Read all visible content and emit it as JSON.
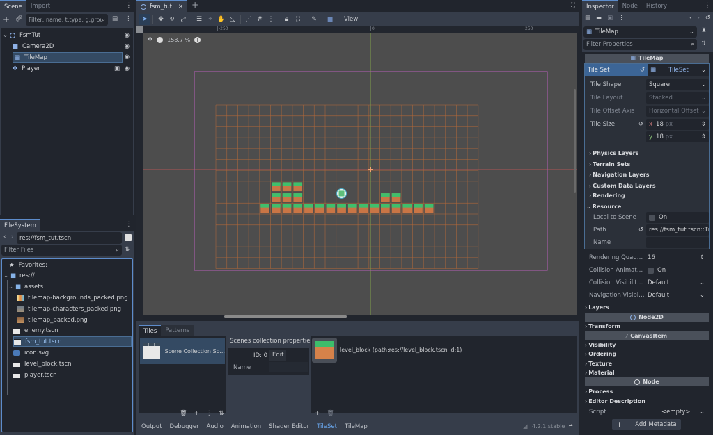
{
  "scene_dock": {
    "tabs": [
      "Scene",
      "Import"
    ],
    "filter_placeholder": "Filter: name, t:type, g:group",
    "nodes": [
      {
        "name": "FsmTut",
        "icon": "node2d-icon"
      },
      {
        "name": "Camera2D",
        "icon": "camera2d-icon"
      },
      {
        "name": "TileMap",
        "icon": "tilemap-icon",
        "selected": true
      },
      {
        "name": "Player",
        "icon": "characterbody-icon"
      }
    ]
  },
  "filesystem": {
    "tab": "FileSystem",
    "path": "res://fsm_tut.tscn",
    "filter_placeholder": "Filter Files",
    "favorites_label": "Favorites:",
    "root": "res://",
    "folder": "assets",
    "asset_files": [
      "tilemap-backgrounds_packed.png",
      "tilemap-characters_packed.png",
      "tilemap_packed.png"
    ],
    "root_files": [
      "enemy.tscn",
      "fsm_tut.tscn",
      "icon.svg",
      "level_block.tscn",
      "player.tscn"
    ],
    "selected_file": "fsm_tut.tscn"
  },
  "editor": {
    "scene_tab": "fsm_tut",
    "view_menu": "View",
    "zoom_level": "158.7 %",
    "ruler_labels": [
      "-250",
      "0",
      "250"
    ]
  },
  "bottom_panel": {
    "tabs": [
      "Tiles",
      "Patterns"
    ],
    "source_item": "Scene Collection So...",
    "props_title": "Scenes collection properties:",
    "id_label": "ID: 0",
    "edit_label": "Edit",
    "name_label": "Name",
    "scene_entry": "level_block (path:res://level_block.tscn id:1)",
    "dock_tabs": [
      "Output",
      "Debugger",
      "Audio",
      "Animation",
      "Shader Editor",
      "TileSet",
      "TileMap"
    ],
    "active_dock_tab": "TileSet",
    "version": "4.2.1.stable"
  },
  "inspector": {
    "tabs": [
      "Inspector",
      "Node",
      "History"
    ],
    "object_name": "TileMap",
    "filter_placeholder": "Filter Properties",
    "class_header": "TileMap",
    "tile_set_label": "Tile Set",
    "tile_set_value": "TileSet",
    "tile_shape_label": "Tile Shape",
    "tile_shape_value": "Square",
    "tile_layout_label": "Tile Layout",
    "tile_layout_value": "Stacked",
    "tile_offset_label": "Tile Offset Axis",
    "tile_offset_value": "Horizontal Offset",
    "tile_size_label": "Tile Size",
    "tile_size_x": "18",
    "tile_size_y": "18",
    "unit": "px",
    "x_label": "x",
    "y_label": "y",
    "subsections": [
      "Physics Layers",
      "Terrain Sets",
      "Navigation Layers",
      "Custom Data Layers",
      "Rendering"
    ],
    "resource_label": "Resource",
    "local_to_scene_label": "Local to Scene",
    "on_label": "On",
    "path_label": "Path",
    "path_value": "res://fsm_tut.tscn::Til",
    "name_label": "Name",
    "quadrant_label": "Rendering Quadrant...",
    "quadrant_value": "16",
    "collision_anim_label": "Collision Animatable",
    "collision_vis_label": "Collision Visibility M...",
    "collision_vis_value": "Default",
    "nav_vis_label": "Navigation Visibility ...",
    "nav_vis_value": "Default",
    "layers_label": "Layers",
    "node2d_header": "Node2D",
    "transform_label": "Transform",
    "canvasitem_header": "CanvasItem",
    "canvas_sections": [
      "Visibility",
      "Ordering",
      "Texture",
      "Material"
    ],
    "node_header": "Node",
    "node_sections": [
      "Process",
      "Editor Description"
    ],
    "script_label": "Script",
    "script_value": "<empty>",
    "add_metadata": "Add Metadata"
  },
  "colors": {
    "accent": "#5d8ccb",
    "selection": "#344a63",
    "viewport_bg": "#4d4d4d",
    "grid": "#b0683a",
    "camera_rect": "#a45ca6"
  }
}
